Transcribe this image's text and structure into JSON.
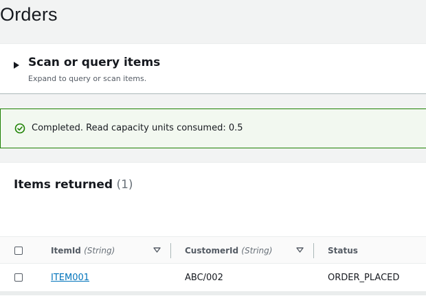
{
  "page": {
    "title": "Orders"
  },
  "scan_panel": {
    "title": "Scan or query items",
    "description": "Expand to query or scan items."
  },
  "alert": {
    "message": "Completed. Read capacity units consumed: 0.5",
    "icon": "success-check-icon",
    "color": "#1d8102"
  },
  "items": {
    "title": "Items returned",
    "count": "(1)",
    "columns": [
      {
        "name": "ItemId",
        "type": "(String)"
      },
      {
        "name": "CustomerId",
        "type": "(String)"
      },
      {
        "name": "Status",
        "type": ""
      }
    ],
    "rows": [
      {
        "item_id": "ITEM001",
        "customer_id": "ABC/002",
        "status": "ORDER_PLACED"
      }
    ]
  },
  "colors": {
    "link": "#0073bb",
    "success": "#1d8102",
    "background": "#f2f3f3"
  }
}
